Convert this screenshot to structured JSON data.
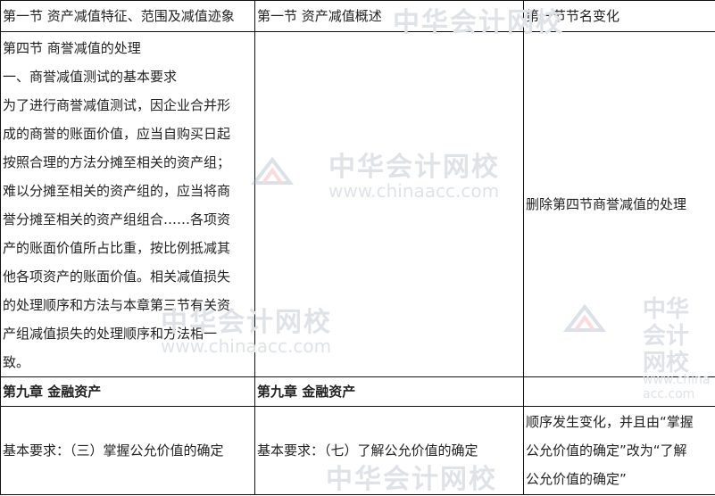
{
  "header": {
    "col1": "第一节 资产减值特征、范围及减值迹象",
    "col2": "第一节 资产减值概述",
    "col3": "第一节节名变化"
  },
  "row2": {
    "col1_lines": [
      "第四节 商誉减值的处理",
      "一、商誉减值测试的基本要求",
      "为了进行商誉减值测试，因企业合并形",
      "成的商誉的账面价值，应当自购买日起",
      "按照合理的方法分摊至相关的资产组；",
      "难以分摊至相关的资产组的，应当将商",
      "誉分摊至相关的资产组组合……各项资",
      "产的账面价值所占比重，按比例抵减其",
      "他各项资产的账面价值。相关减值损失",
      "的处理顺序和方法与本章第三节有关资",
      "产组减值损失的处理顺序和方法相一",
      "致。"
    ],
    "col2": "",
    "col3": "删除第四节商誉减值的处理"
  },
  "row3": {
    "col1": "第九章 金融资产",
    "col2": "第九章 金融资产",
    "col3": ""
  },
  "row4": {
    "col1": "基本要求：（三）掌握公允价值的确定",
    "col2": "基本要求：（七）了解公允价值的确定",
    "col3_lines": [
      "顺序发生变化，并且由“掌握",
      "公允价值的确定”改为“了解",
      "公允价值的确定”"
    ]
  },
  "watermark": {
    "cn": "中华会计网校",
    "en": "www.chinaacc.com"
  }
}
